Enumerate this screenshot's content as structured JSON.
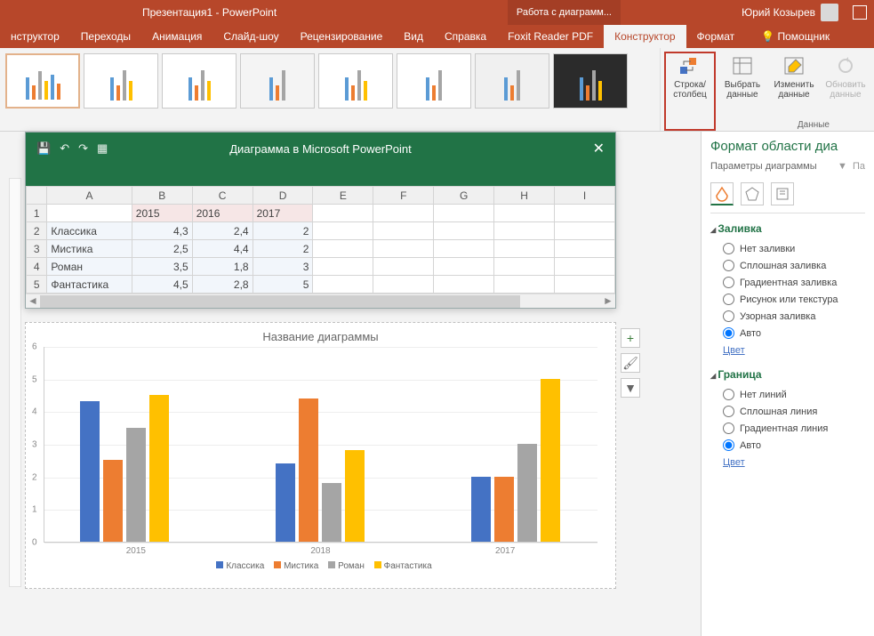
{
  "titlebar": {
    "doc": "Презентация1 - PowerPoint",
    "context": "Работа с диаграмм...",
    "user": "Юрий Козырев"
  },
  "tabs": {
    "t0": "нструктор",
    "t1": "Переходы",
    "t2": "Анимация",
    "t3": "Слайд-шоу",
    "t4": "Рецензирование",
    "t5": "Вид",
    "t6": "Справка",
    "t7": "Foxit Reader PDF",
    "ctx1": "Конструктор",
    "ctx2": "Формат",
    "help": "Помощник"
  },
  "ribbon": {
    "switch": "Строка/столбец",
    "select": "Выбрать данные",
    "edit": "Изменить данные",
    "refresh": "Обновить данные",
    "group": "Данные"
  },
  "excel": {
    "title": "Диаграмма в Microsoft PowerPoint",
    "cols": {
      "A": "A",
      "B": "B",
      "C": "C",
      "D": "D",
      "E": "E",
      "F": "F",
      "G": "G",
      "H": "H",
      "I": "I"
    },
    "rows": [
      "1",
      "2",
      "3",
      "4",
      "5"
    ],
    "headers": {
      "b1": "2015",
      "c1": "2016",
      "d1": "2017"
    },
    "data": {
      "a2": "Классика",
      "b2": "4,3",
      "c2": "2,4",
      "d2": "2",
      "a3": "Мистика",
      "b3": "2,5",
      "c3": "4,4",
      "d3": "2",
      "a4": "Роман",
      "b4": "3,5",
      "c4": "1,8",
      "d4": "3",
      "a5": "Фантастика",
      "b5": "4,5",
      "c5": "2,8",
      "d5": "5"
    }
  },
  "chart_data": {
    "type": "bar",
    "title": "Название диаграммы",
    "categories": [
      "2015",
      "2016",
      "2018",
      "2017"
    ],
    "series": [
      {
        "name": "Классика",
        "values": [
          4.3,
          2.4,
          2,
          2
        ],
        "color": "#4472c4"
      },
      {
        "name": "Мистика",
        "values": [
          2.5,
          4.4,
          2,
          2
        ],
        "color": "#ed7d31"
      },
      {
        "name": "Роман",
        "values": [
          3.5,
          1.8,
          3,
          3
        ],
        "color": "#a5a5a5"
      },
      {
        "name": "Фантастика",
        "values": [
          4.5,
          2.8,
          5,
          5
        ],
        "color": "#ffc000"
      }
    ],
    "xlabel": "",
    "ylabel": "",
    "ylim": [
      0,
      6
    ],
    "yticks": [
      0,
      1,
      2,
      3,
      4,
      5,
      6
    ],
    "xlabels_display": {
      "x0": "2015",
      "x1": "2018",
      "x2": "2017"
    },
    "legend": {
      "l0": "Классика",
      "l1": "Мистика",
      "l2": "Роман",
      "l3": "Фантастика"
    }
  },
  "format": {
    "title": "Формат области диа",
    "subtitle": "Параметры диаграммы",
    "subtitle2": "Па",
    "fill": {
      "h": "Заливка",
      "r0": "Нет заливки",
      "r1": "Сплошная заливка",
      "r2": "Градиентная заливка",
      "r3": "Рисунок или текстура",
      "r4": "Узорная заливка",
      "r5": "Авто"
    },
    "color": "Цвет",
    "border": {
      "h": "Граница",
      "r0": "Нет линий",
      "r1": "Сплошная линия",
      "r2": "Градиентная линия",
      "r3": "Авто"
    }
  }
}
